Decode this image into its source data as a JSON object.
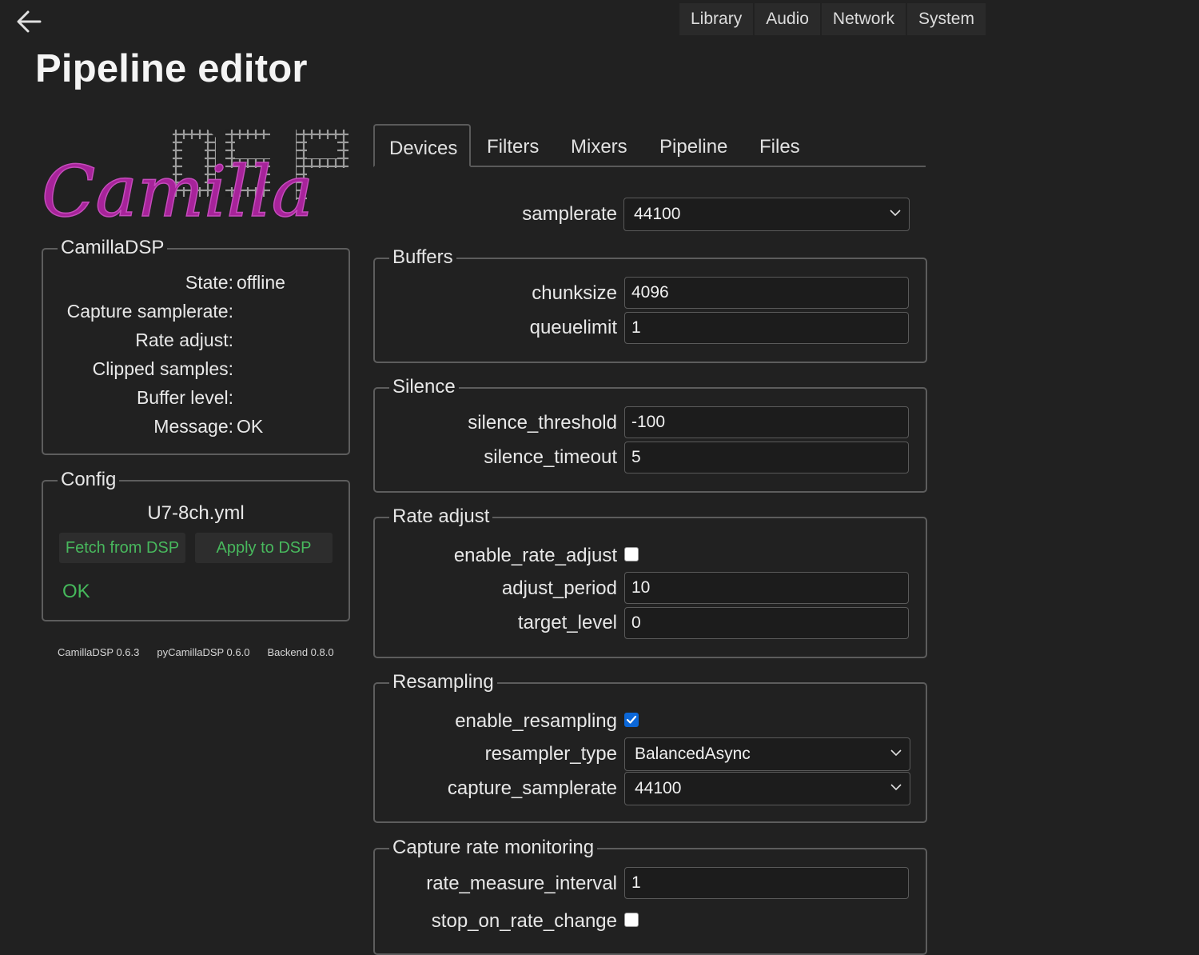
{
  "nav": {
    "items": [
      "Library",
      "Audio",
      "Network",
      "System"
    ]
  },
  "page": {
    "title": "Pipeline editor"
  },
  "status": {
    "legend": "CamillaDSP",
    "rows": [
      {
        "label": "State:",
        "value": "offline"
      },
      {
        "label": "Capture samplerate:",
        "value": ""
      },
      {
        "label": "Rate adjust:",
        "value": ""
      },
      {
        "label": "Clipped samples:",
        "value": ""
      },
      {
        "label": "Buffer level:",
        "value": ""
      },
      {
        "label": "Message:",
        "value": "OK"
      }
    ]
  },
  "config": {
    "legend": "Config",
    "filename": "U7-8ch.yml",
    "fetch_label": "Fetch from DSP",
    "apply_label": "Apply to DSP",
    "status": "OK"
  },
  "versions": [
    "CamillaDSP 0.6.3",
    "pyCamillaDSP 0.6.0",
    "Backend 0.8.0"
  ],
  "tabs": [
    "Devices",
    "Filters",
    "Mixers",
    "Pipeline",
    "Files"
  ],
  "devices": {
    "samplerate": {
      "label": "samplerate",
      "value": "44100"
    },
    "buffers": {
      "legend": "Buffers",
      "chunksize": {
        "label": "chunksize",
        "value": "4096"
      },
      "queuelimit": {
        "label": "queuelimit",
        "value": "1"
      }
    },
    "silence": {
      "legend": "Silence",
      "threshold": {
        "label": "silence_threshold",
        "value": "-100"
      },
      "timeout": {
        "label": "silence_timeout",
        "value": "5"
      }
    },
    "rate_adjust": {
      "legend": "Rate adjust",
      "enable": {
        "label": "enable_rate_adjust",
        "checked": false
      },
      "period": {
        "label": "adjust_period",
        "value": "10"
      },
      "target": {
        "label": "target_level",
        "value": "0"
      }
    },
    "resampling": {
      "legend": "Resampling",
      "enable": {
        "label": "enable_resampling",
        "checked": true
      },
      "type": {
        "label": "resampler_type",
        "value": "BalancedAsync"
      },
      "capture_samplerate": {
        "label": "capture_samplerate",
        "value": "44100"
      }
    },
    "capture_rate": {
      "legend": "Capture rate monitoring",
      "interval": {
        "label": "rate_measure_interval",
        "value": "1"
      },
      "stop": {
        "label": "stop_on_rate_change",
        "checked": false
      }
    }
  },
  "colors": {
    "background": "#212121",
    "accent_green": "#45b85b",
    "checkbox_blue": "#0b67d8",
    "logo_purple": "#a7239a"
  }
}
